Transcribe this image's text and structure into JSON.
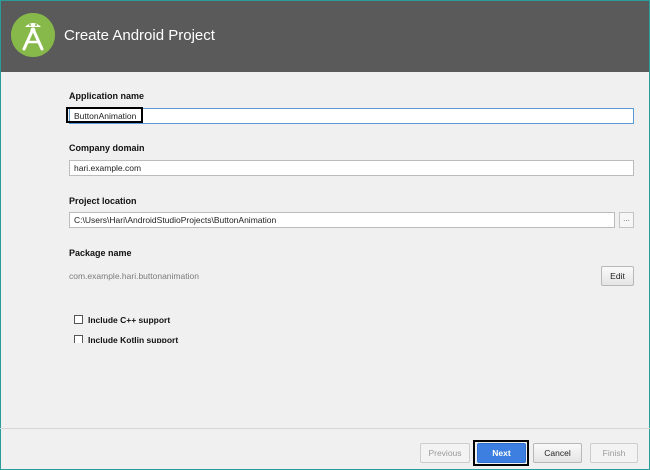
{
  "header": {
    "title": "Create Android Project"
  },
  "form": {
    "app_name": {
      "label": "Application name",
      "value": "ButtonAnimation"
    },
    "company_domain": {
      "label": "Company domain",
      "value": "hari.example.com"
    },
    "project_location": {
      "label": "Project location",
      "value": "C:\\Users\\Hari\\AndroidStudioProjects\\ButtonAnimation",
      "browse_label": "..."
    },
    "package_name": {
      "label": "Package name",
      "value": "com.example.hari.buttonanimation",
      "edit_label": "Edit"
    }
  },
  "options": {
    "cpp_support": {
      "label": "Include C++ support",
      "checked": false
    },
    "kotlin_support": {
      "label": "Include Kotlin support",
      "checked": false
    }
  },
  "footer": {
    "previous_label": "Previous",
    "next_label": "Next",
    "cancel_label": "Cancel",
    "finish_label": "Finish"
  },
  "colors": {
    "header_bg": "#5a5a5a",
    "logo_green": "#86b84a",
    "primary_button": "#3d7fe0"
  },
  "icons": {
    "logo": "android-studio-logo-icon"
  }
}
